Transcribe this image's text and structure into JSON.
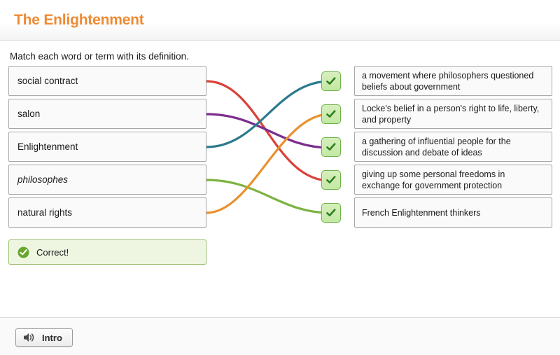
{
  "header": {
    "title": "The Enlightenment",
    "accent_color": "#f08a33"
  },
  "instruction": "Match each word or term with its definition.",
  "terms": [
    {
      "label": "social contract",
      "italic": false,
      "line_color": "#d9423a",
      "connects_to_slot": 4
    },
    {
      "label": "salon",
      "italic": false,
      "line_color": "#7b2d8e",
      "connects_to_slot": 3
    },
    {
      "label": "Enlightenment",
      "italic": false,
      "line_color": "#2a7a8c",
      "connects_to_slot": 1
    },
    {
      "label": "philosophes",
      "italic": true,
      "line_color": "#7cb342",
      "connects_to_slot": 5
    },
    {
      "label": "natural rights",
      "italic": false,
      "line_color": "#e8922e",
      "connects_to_slot": 2
    }
  ],
  "definitions": [
    {
      "text": "a movement where philosophers questioned beliefs about government",
      "check_icon": "check-icon"
    },
    {
      "text": "Locke's belief in a person's right to life, liberty, and property",
      "check_icon": "check-icon"
    },
    {
      "text": "a gathering of influential people for the discussion and debate of ideas",
      "check_icon": "check-icon"
    },
    {
      "text": "giving up some personal freedoms in exchange for government protection",
      "check_icon": "check-icon"
    },
    {
      "text": "French Enlightenment thinkers",
      "check_icon": "check-icon"
    }
  ],
  "feedback": {
    "text": "Correct!",
    "icon": "check-circle-icon",
    "color": "#6aa62f"
  },
  "footer": {
    "intro_label": "Intro",
    "intro_icon": "speaker-icon"
  }
}
